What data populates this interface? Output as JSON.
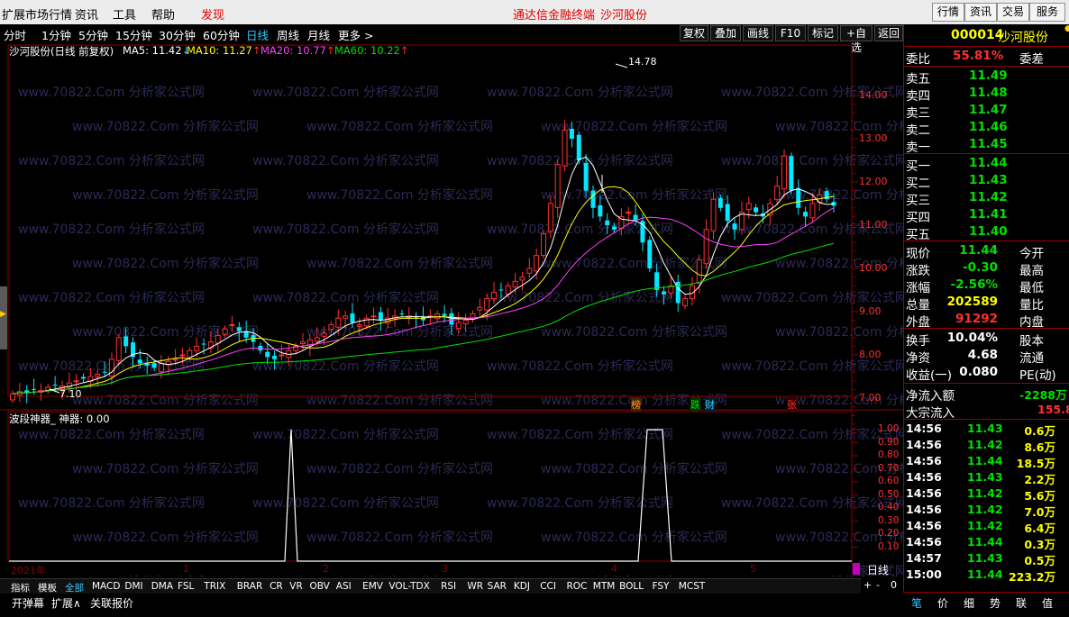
{
  "menu": {
    "items": [
      "扩展市场行情",
      "资讯",
      "工具",
      "帮助"
    ],
    "discover": "发现",
    "center_title": "通达信金融终端",
    "center_stock": "沙河股份",
    "right_buttons": [
      "行情",
      "资讯",
      "交易",
      "服务"
    ]
  },
  "periods": [
    "分时",
    "1分钟",
    "5分钟",
    "15分钟",
    "30分钟",
    "60分钟",
    "日线",
    "周线",
    "月线",
    "更多 >"
  ],
  "active_period": "日线",
  "toolbar": [
    "复权",
    "叠加",
    "画线",
    "F10",
    "标记",
    "+自选",
    "返回"
  ],
  "legend": {
    "title": "沙河股份(日线 前复权)",
    "ma5": "MA5: 11.42",
    "ma10": "MA10: 11.27",
    "ma20": "MA20: 10.77",
    "ma60": "MA60: 10.22",
    "ma5_arrow": "↓",
    "ma10_arrow": "↑",
    "ma20_arrow": "↑",
    "ma60_arrow": "↑"
  },
  "price_axis": [
    "14.00",
    "13.00",
    "12.00",
    "11.00",
    "10.00",
    "9.00",
    "8.00",
    "7.00"
  ],
  "high_marker": "14.78",
  "low_marker": "7.10",
  "event_markers": [
    "榜",
    "跌",
    "财",
    "张"
  ],
  "watermark": "www.70822.Com 分析家公式网",
  "indicator": {
    "title": "波段神器_",
    "value_label": "神器: 0.00",
    "axis": [
      "1.00",
      "0.90",
      "0.80",
      "0.70",
      "0.60",
      "0.50",
      "0.40",
      "0.30",
      "0.20",
      "0.10"
    ]
  },
  "time_axis": {
    "year_label": "2021年",
    "months": [
      "1",
      "2",
      "3",
      "4",
      "5"
    ],
    "period_label": "日线"
  },
  "indicator_tabs": [
    "指标",
    "模板",
    "全部",
    "MACD",
    "DMI",
    "DMA",
    "FSL",
    "TRIX",
    "BRAR",
    "CR",
    "VR",
    "OBV",
    "ASI",
    "EMV",
    "VOL-TDX",
    "RSI",
    "WR",
    "SAR",
    "KDJ",
    "CCI",
    "ROC",
    "MTM",
    "BOLL",
    "FSY",
    "MCST"
  ],
  "active_indicator_tab": "全部",
  "zoom_controls": [
    "+",
    "-",
    "0"
  ],
  "bottom_tabs": [
    "开弹幕",
    "扩展∧",
    "关联报价"
  ],
  "quote": {
    "code": "000014",
    "name": "沙河股份",
    "weibi_label": "委比",
    "weibi_value": "55.81%",
    "weicha_label": "委差",
    "sells": [
      {
        "label": "卖五",
        "price": "11.49"
      },
      {
        "label": "卖四",
        "price": "11.48"
      },
      {
        "label": "卖三",
        "price": "11.47"
      },
      {
        "label": "卖二",
        "price": "11.46"
      },
      {
        "label": "卖一",
        "price": "11.45"
      }
    ],
    "buys": [
      {
        "label": "买一",
        "price": "11.44"
      },
      {
        "label": "买二",
        "price": "11.43"
      },
      {
        "label": "买三",
        "price": "11.42"
      },
      {
        "label": "买四",
        "price": "11.41"
      },
      {
        "label": "买五",
        "price": "11.40"
      }
    ],
    "stats": [
      {
        "l": "现价",
        "v": "11.44",
        "l2": "今开",
        "c": "#00e000"
      },
      {
        "l": "涨跌",
        "v": "-0.30",
        "l2": "最高",
        "c": "#00e000"
      },
      {
        "l": "涨幅",
        "v": "-2.56%",
        "l2": "最低",
        "c": "#00e000"
      },
      {
        "l": "总量",
        "v": "202589",
        "l2": "量比",
        "c": "#ffff00"
      },
      {
        "l": "外盘",
        "v": "91292",
        "l2": "内盘",
        "c": "#ff3030"
      }
    ],
    "stats2": [
      {
        "l": "换手",
        "v": "10.04%",
        "l2": "股本"
      },
      {
        "l": "净资",
        "v": "4.68",
        "l2": "流通"
      },
      {
        "l": "收益(一)",
        "v": "0.080",
        "l2": "PE(动)"
      }
    ],
    "inflow_label": "净流入额",
    "inflow_value": "-2288万",
    "block_label": "大宗流入",
    "block_value": "155.8",
    "ticks": [
      {
        "t": "14:56",
        "p": "11.43",
        "v": "0.6万"
      },
      {
        "t": "14:56",
        "p": "11.42",
        "v": "8.6万"
      },
      {
        "t": "14:56",
        "p": "11.44",
        "v": "18.5万"
      },
      {
        "t": "14:56",
        "p": "11.43",
        "v": "2.2万"
      },
      {
        "t": "14:56",
        "p": "11.42",
        "v": "5.6万"
      },
      {
        "t": "14:56",
        "p": "11.42",
        "v": "7.0万"
      },
      {
        "t": "14:56",
        "p": "11.42",
        "v": "6.4万"
      },
      {
        "t": "14:56",
        "p": "11.44",
        "v": "0.3万"
      },
      {
        "t": "14:57",
        "p": "11.43",
        "v": "0.5万"
      },
      {
        "t": "15:00",
        "p": "11.44",
        "v": "223.2万"
      }
    ],
    "tabs": [
      "笔",
      "价",
      "细",
      "势",
      "联",
      "值"
    ]
  }
}
